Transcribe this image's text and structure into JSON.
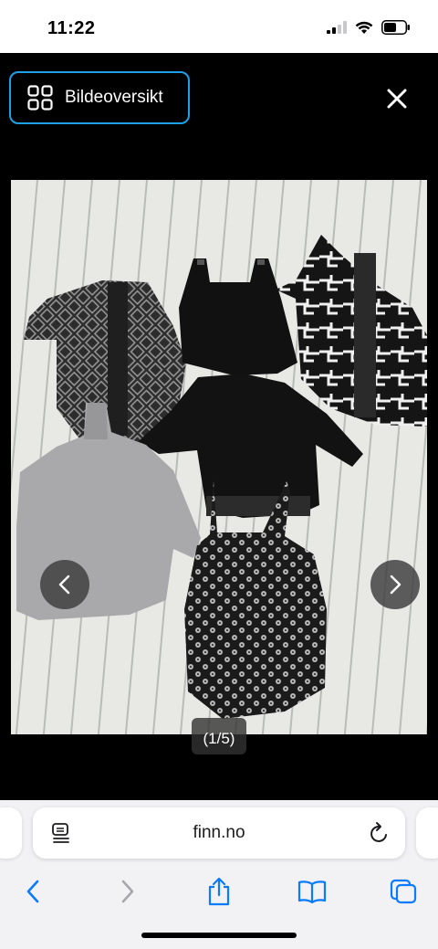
{
  "status_bar": {
    "time": "11:22"
  },
  "viewer": {
    "overview_label": "Bildeoversikt",
    "counter": "(1/5)"
  },
  "browser": {
    "url": "finn.no"
  },
  "colors": {
    "accent": "#1ea0e6",
    "ios_blue": "#0a7aff",
    "disabled": "#a7a7ab"
  },
  "icons": [
    "grid-icon",
    "close-icon",
    "chevron-left-icon",
    "chevron-right-icon",
    "reader-icon",
    "reload-icon",
    "back-icon",
    "forward-icon",
    "share-icon",
    "bookmarks-icon",
    "tabs-icon"
  ]
}
